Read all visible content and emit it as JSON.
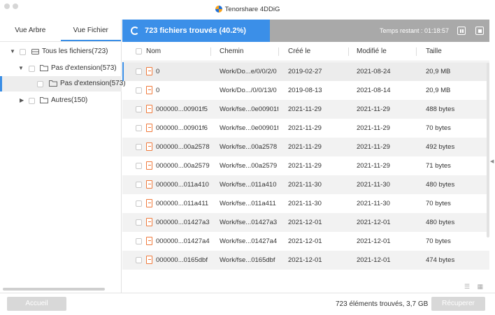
{
  "window": {
    "title": "Tenorshare 4DDiG"
  },
  "left_panel": {
    "tabs": [
      {
        "label": "Vue Arbre",
        "active": false
      },
      {
        "label": "Vue Fichier",
        "active": true
      }
    ],
    "tree": [
      {
        "label": "Tous les fichiers(723)",
        "expanded": true,
        "icon": "drive-icon"
      },
      {
        "label": "Pas d'extension(573)",
        "expanded": true,
        "icon": "folder-icon"
      },
      {
        "label": "Pas d'extension(573)",
        "selected": true,
        "icon": "folder-icon"
      },
      {
        "label": "Autres(150)",
        "expanded": false,
        "icon": "folder-icon"
      }
    ]
  },
  "progress": {
    "status": "723 fichiers trouvés (40.2%)",
    "fraction": 0.402,
    "time_remaining": "Temps restant : 01:18:57",
    "pause_icon": "pause-icon",
    "stop_icon": "stop-icon"
  },
  "table": {
    "columns": [
      "Nom",
      "Chemin",
      "Créé le",
      "Modifié le",
      "Taille"
    ],
    "rows": [
      {
        "name": "0",
        "path": "Work/Do...e/0/0/2/0",
        "created": "2019-02-27",
        "modified": "2021-08-24",
        "size": "20,9 MB",
        "selected": true
      },
      {
        "name": "0",
        "path": "Work/Do.../0/0/13/0",
        "created": "2019-08-13",
        "modified": "2021-08-14",
        "size": "20,9 MB"
      },
      {
        "name": "000000...00901f5",
        "path": "Work/fse...0e00901f5",
        "created": "2021-11-29",
        "modified": "2021-11-29",
        "size": "488 bytes"
      },
      {
        "name": "000000...00901f6",
        "path": "Work/fse...0e00901f6",
        "created": "2021-11-29",
        "modified": "2021-11-29",
        "size": "70 bytes"
      },
      {
        "name": "000000...00a2578",
        "path": "Work/fse...00a2578",
        "created": "2021-11-29",
        "modified": "2021-11-29",
        "size": "492 bytes"
      },
      {
        "name": "000000...00a2579",
        "path": "Work/fse...00a2579",
        "created": "2021-11-29",
        "modified": "2021-11-29",
        "size": "71 bytes"
      },
      {
        "name": "000000...011a410",
        "path": "Work/fse...011a410",
        "created": "2021-11-30",
        "modified": "2021-11-30",
        "size": "480 bytes"
      },
      {
        "name": "000000...011a411",
        "path": "Work/fse...011a411",
        "created": "2021-11-30",
        "modified": "2021-11-30",
        "size": "70 bytes"
      },
      {
        "name": "000000...01427a3",
        "path": "Work/fse...01427a3",
        "created": "2021-12-01",
        "modified": "2021-12-01",
        "size": "480 bytes"
      },
      {
        "name": "000000...01427a4",
        "path": "Work/fse...01427a4",
        "created": "2021-12-01",
        "modified": "2021-12-01",
        "size": "70 bytes"
      },
      {
        "name": "000000...0165dbf",
        "path": "Work/fse...0165dbf",
        "created": "2021-12-01",
        "modified": "2021-12-01",
        "size": "474 bytes"
      }
    ]
  },
  "footer": {
    "home_button": "Accueil",
    "summary": "723 éléments trouvés, 3,7 GB",
    "recover_button": "Récuperer"
  },
  "colors": {
    "accent": "#3b8fe8",
    "progress_track": "#a9a9a9",
    "file_icon": "#f07a3c"
  }
}
